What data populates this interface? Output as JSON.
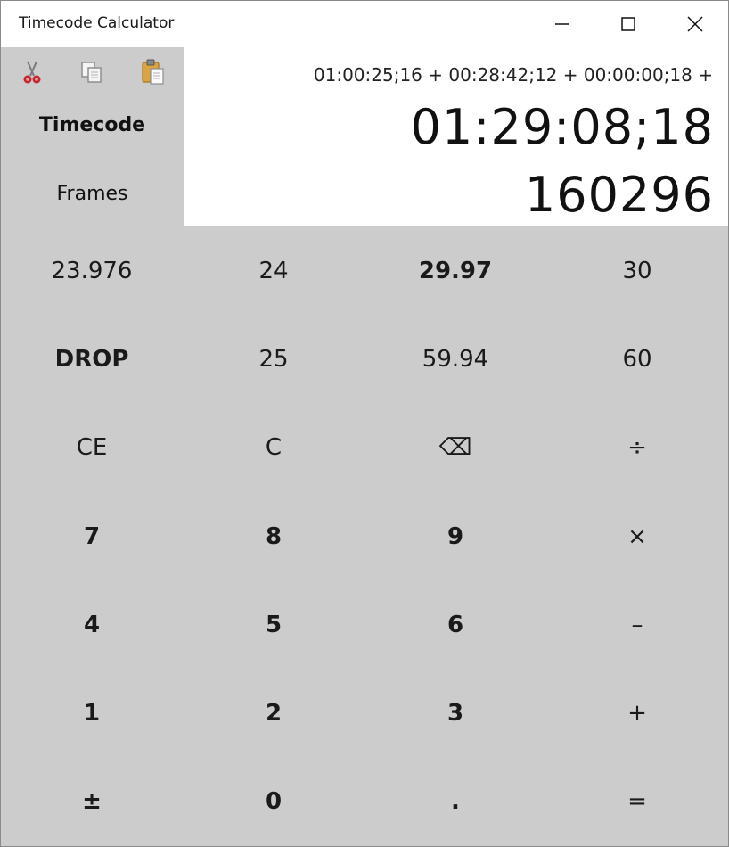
{
  "window": {
    "title": "Timecode Calculator"
  },
  "clipboard": {
    "cut_icon": "scissors-icon",
    "copy_icon": "copy-icon",
    "paste_icon": "paste-icon"
  },
  "modes": {
    "timecode": "Timecode",
    "frames": "Frames"
  },
  "display": {
    "expression": "01:00:25;16 + 00:28:42;12 + 00:00:00;18 +",
    "timecode_result": "01:29:08;18",
    "frames_result": "160296"
  },
  "keypad": {
    "rows": [
      [
        "23.976",
        "24",
        "29.97",
        "30"
      ],
      [
        "DROP",
        "25",
        "59.94",
        "60"
      ],
      [
        "CE",
        "C",
        "⌫",
        "÷"
      ],
      [
        "7",
        "8",
        "9",
        "×"
      ],
      [
        "4",
        "5",
        "6",
        "–"
      ],
      [
        "1",
        "2",
        "3",
        "+"
      ],
      [
        "±",
        "0",
        ".",
        "="
      ]
    ]
  },
  "colors": {
    "panel_gray": "#cccccc",
    "background": "#ffffff",
    "text": "#111111"
  }
}
